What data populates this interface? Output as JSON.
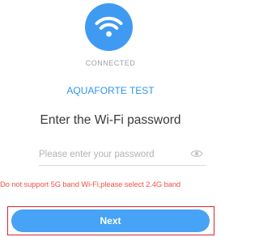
{
  "connection": {
    "icon": "wifi-icon",
    "status": "CONNECTED",
    "network_name": "AQUAFORTE TEST"
  },
  "form": {
    "heading": "Enter the Wi-Fi password",
    "password_placeholder": "Please enter your password",
    "password_value": "",
    "visibility_icon": "eye-icon",
    "warning": "Do not support 5G band Wi-Fi,please select 2.4G band"
  },
  "actions": {
    "next_label": "Next"
  },
  "colors": {
    "accent": "#46a3f5",
    "warning": "#f0524a",
    "highlight_frame": "#d7262d"
  }
}
